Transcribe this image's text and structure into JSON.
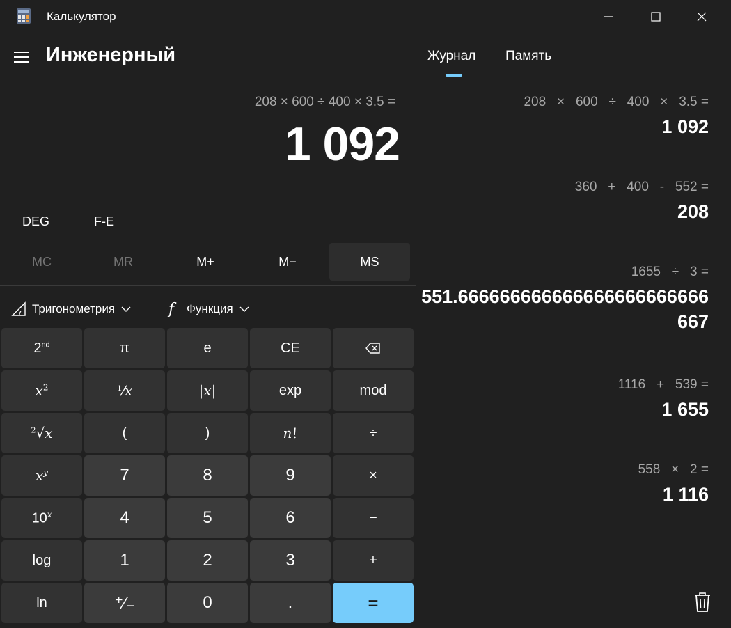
{
  "window": {
    "title": "Калькулятор",
    "icons": [
      "calculator-app-icon",
      "minimize-icon",
      "maximize-icon",
      "close-icon"
    ]
  },
  "header": {
    "mode": "Инженерный"
  },
  "display": {
    "expression": "208 × 600 ÷ 400 × 3.5 =",
    "result": "1 092"
  },
  "modes": {
    "angle": "DEG",
    "fe": "F-E"
  },
  "memory": [
    "MC",
    "MR",
    "M+",
    "M−",
    "MS"
  ],
  "functions": {
    "trig": "Тригонометрия",
    "func": "Функция"
  },
  "keys": [
    [
      "2nd",
      "π",
      "e",
      "CE",
      "backspace"
    ],
    [
      "x²",
      "¹⁄x",
      "|x|",
      "exp",
      "mod"
    ],
    [
      "²√x",
      "(",
      ")",
      "n!",
      "÷"
    ],
    [
      "xʸ",
      "7",
      "8",
      "9",
      "×"
    ],
    [
      "10ˣ",
      "4",
      "5",
      "6",
      "−"
    ],
    [
      "log",
      "1",
      "2",
      "3",
      "+"
    ],
    [
      "ln",
      "⁺⁄₋",
      "0",
      ".",
      "="
    ]
  ],
  "tabs": {
    "journal": "Журнал",
    "memory": "Память"
  },
  "history": [
    {
      "expression": "208   ×   600   ÷   400   ×   3.5 =",
      "result": "1 092"
    },
    {
      "expression": "360   +   400   -   552 =",
      "result": "208"
    },
    {
      "expression": "1655   ÷   3 =",
      "result": "551.666666666666666666666666667"
    },
    {
      "expression": "1116   +   539 =",
      "result": "1 655"
    },
    {
      "expression": "558   ×   2 =",
      "result": "1 116"
    }
  ],
  "colors": {
    "background": "#202020",
    "key": "#323232",
    "number_key": "#3b3b3b",
    "accent": "#76ccfb",
    "muted_text": "#a8a8a8"
  }
}
